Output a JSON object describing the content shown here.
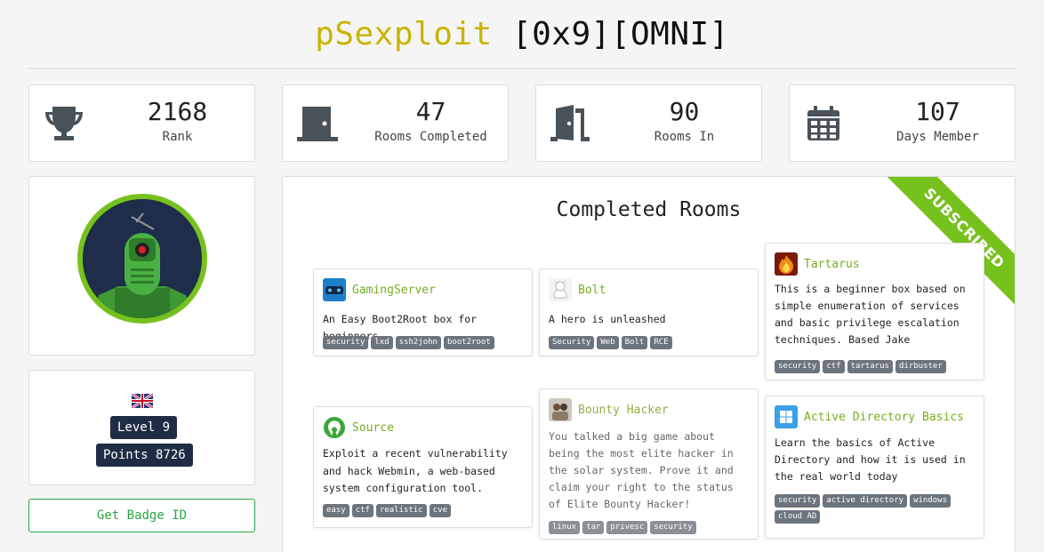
{
  "header": {
    "username": "pSexploit",
    "tags": "[0x9][OMNI]"
  },
  "stats": [
    {
      "icon": "trophy-icon",
      "value": "2168",
      "label": "Rank"
    },
    {
      "icon": "door-closed-icon",
      "value": "47",
      "label": "Rooms Completed"
    },
    {
      "icon": "door-open-icon",
      "value": "90",
      "label": "Rooms In"
    },
    {
      "icon": "calendar-icon",
      "value": "107",
      "label": "Days Member"
    }
  ],
  "profile": {
    "level": "Level 9",
    "points": "Points 8726",
    "badge_button": "Get Badge ID"
  },
  "rooms_panel": {
    "title": "Completed Rooms",
    "ribbon": "SUBSCRIBED"
  },
  "rooms": [
    {
      "name": "GamingServer",
      "description": "An Easy Boot2Root box for beginners",
      "tags": [
        "security",
        "lxd",
        "ssh2john",
        "boot2root"
      ]
    },
    {
      "name": "Bolt",
      "description": "A hero is unleashed",
      "tags": [
        "Security",
        "Web",
        "Bolt",
        "RCE"
      ]
    },
    {
      "name": "Tartarus",
      "description": "This is a beginner box based on simple enumeration of services and basic privilege escalation techniques. Based Jake",
      "tags": [
        "security",
        "ctf",
        "tartarus",
        "dirbuster"
      ]
    },
    {
      "name": "Source",
      "description": "Exploit a recent vulnerability and hack Webmin, a web-based system configuration tool.",
      "tags": [
        "easy",
        "ctf",
        "realistic",
        "cve"
      ]
    },
    {
      "name": "Bounty Hacker",
      "description": "You talked a big game about being the most elite hacker in the solar system. Prove it and claim your right to the status of Elite Bounty Hacker!",
      "tags": [
        "linux",
        "tar",
        "privesc",
        "security"
      ]
    },
    {
      "name": "Active Directory Basics",
      "description": "Learn the basics of Active Directory and how it is used in the real world today",
      "tags": [
        "security",
        "active directory",
        "windows",
        "cloud AD"
      ]
    }
  ],
  "colors": {
    "accent_green": "#77c11e",
    "username_yellow": "#c8b400",
    "dark_pill": "#1f2d44",
    "tag_gray": "#6c757d"
  }
}
